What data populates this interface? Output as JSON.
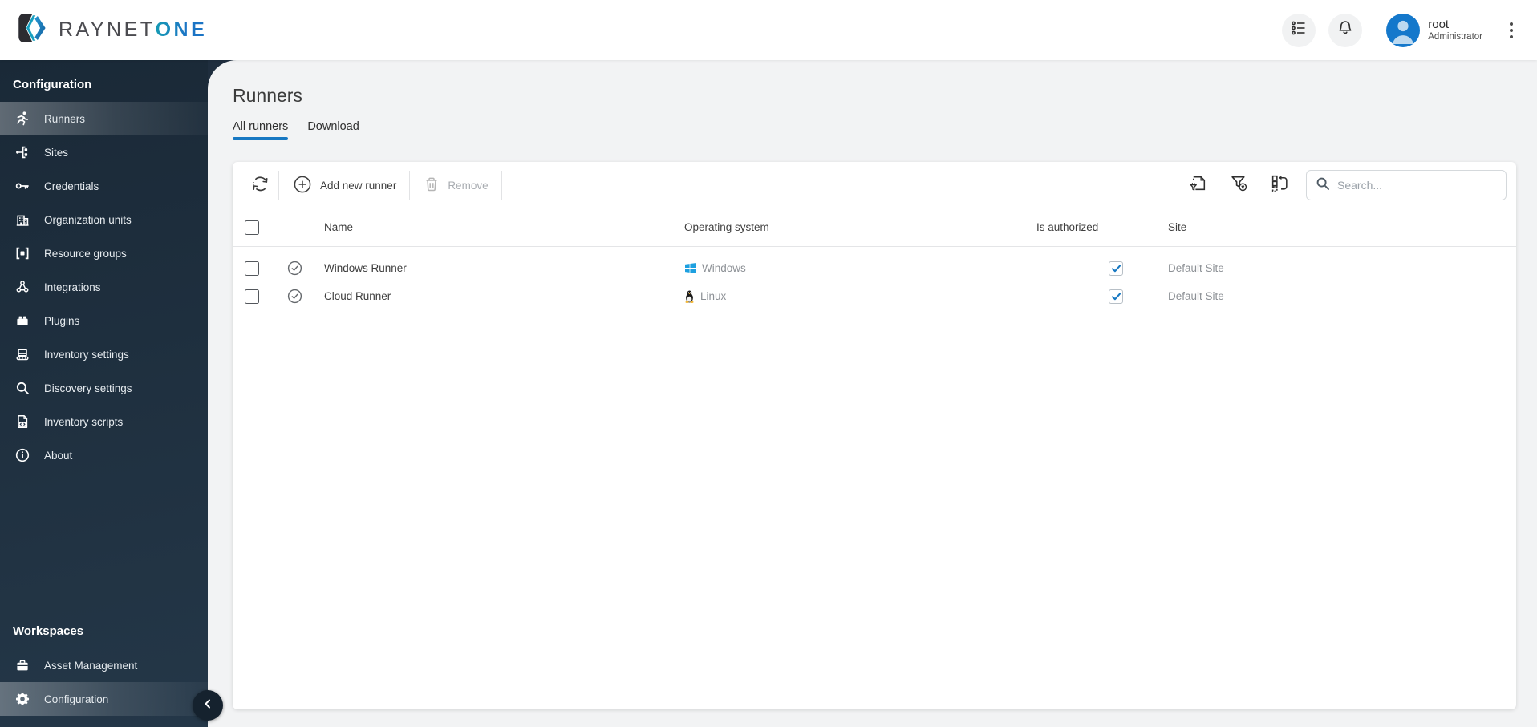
{
  "topbar": {
    "logo": {
      "primary": "RAYNET",
      "secondary": "ONE"
    },
    "user": {
      "name": "root",
      "role": "Administrator"
    }
  },
  "sidebar": {
    "sections": {
      "configuration": "Configuration",
      "workspaces": "Workspaces"
    },
    "items": [
      {
        "label": "Runners",
        "icon": "runner-icon",
        "active": true
      },
      {
        "label": "Sites",
        "icon": "sites-icon",
        "active": false
      },
      {
        "label": "Credentials",
        "icon": "key-icon",
        "active": false
      },
      {
        "label": "Organization units",
        "icon": "building-icon",
        "active": false
      },
      {
        "label": "Resource groups",
        "icon": "resource-groups-icon",
        "active": false
      },
      {
        "label": "Integrations",
        "icon": "integrations-icon",
        "active": false
      },
      {
        "label": "Plugins",
        "icon": "plugin-icon",
        "active": false
      },
      {
        "label": "Inventory settings",
        "icon": "inventory-settings-icon",
        "active": false
      },
      {
        "label": "Discovery settings",
        "icon": "magnifier-icon",
        "active": false
      },
      {
        "label": "Inventory scripts",
        "icon": "script-icon",
        "active": false
      },
      {
        "label": "About",
        "icon": "info-icon",
        "active": false
      }
    ],
    "workspaces": [
      {
        "label": "Asset Management",
        "icon": "toolbox-icon",
        "active": false
      },
      {
        "label": "Configuration",
        "icon": "gear-icon",
        "active": true
      }
    ]
  },
  "page": {
    "title": "Runners",
    "tabs": [
      {
        "label": "All runners",
        "active": true
      },
      {
        "label": "Download",
        "active": false
      }
    ]
  },
  "toolbar": {
    "add_label": "Add new runner",
    "remove_label": "Remove",
    "search_placeholder": "Search..."
  },
  "table": {
    "columns": [
      "Name",
      "Operating system",
      "Is authorized",
      "Site"
    ],
    "rows": [
      {
        "name": "Windows Runner",
        "os": "Windows",
        "os_icon": "windows-logo-icon",
        "authorized": true,
        "site": "Default Site"
      },
      {
        "name": "Cloud Runner",
        "os": "Linux",
        "os_icon": "linux-tux-icon",
        "authorized": true,
        "site": "Default Site"
      }
    ]
  },
  "colors": {
    "accent": "#1778c2",
    "sidebar_dark": "#1f2e3e",
    "windows_blue": "#1da0e0",
    "content_bg": "#f2f3f4",
    "muted_text": "#8d9196"
  }
}
